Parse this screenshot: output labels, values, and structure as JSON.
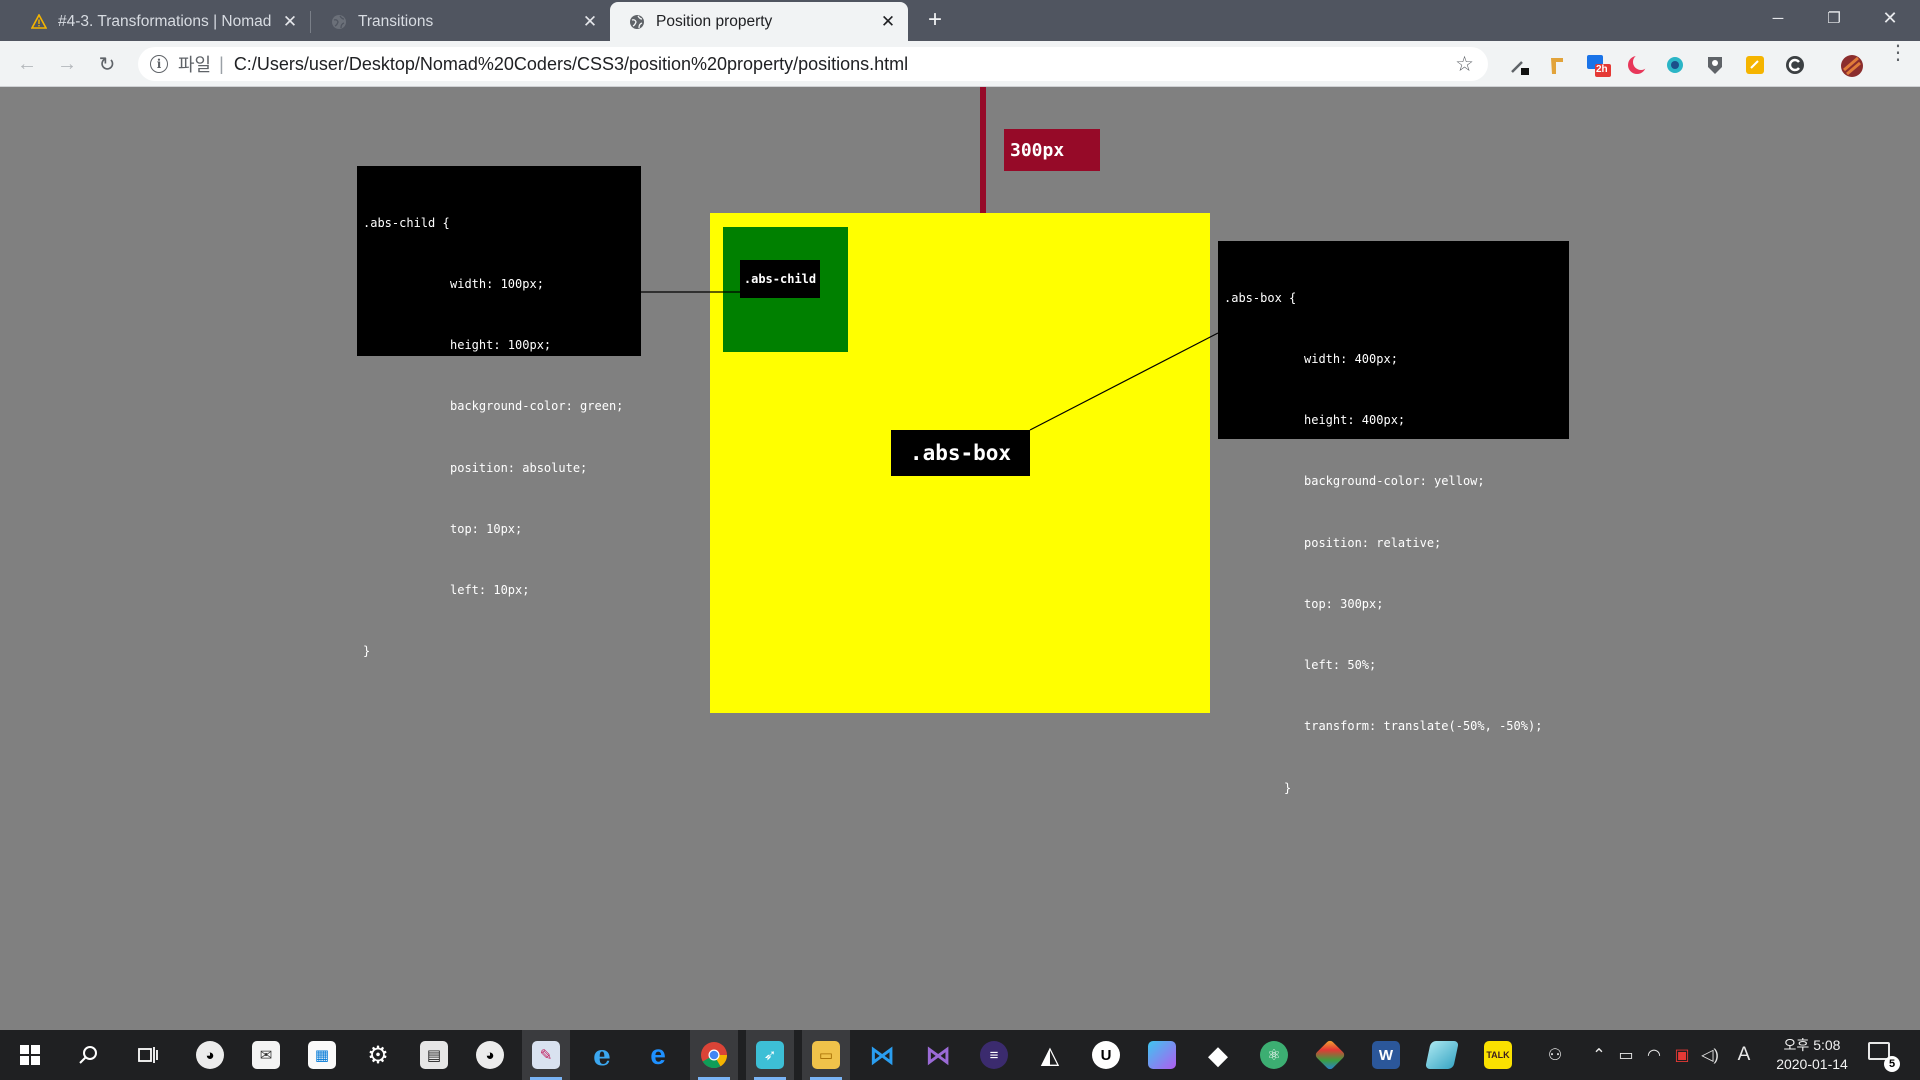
{
  "tabs": [
    {
      "title": "#4-3. Transformations | Nomad",
      "icon": "warning-triangle-icon",
      "active": false
    },
    {
      "title": "Transitions",
      "icon": "globe-icon",
      "active": false
    },
    {
      "title": "Position property",
      "icon": "globe-icon",
      "active": true
    }
  ],
  "address_bar": {
    "scheme_label": "파일",
    "separator": "|",
    "url": "C:/Users/user/Desktop/Nomad%20Coders/CSS3/position%20property/positions.html"
  },
  "extensions": {
    "badge_2h": "2h"
  },
  "page": {
    "red_marker_label": "300px",
    "abs_child_label": ".abs-child",
    "abs_box_label": ".abs-box",
    "child_code": {
      "open": ".abs-child {",
      "lines": [
        "width: 100px;",
        "height: 100px;",
        "background-color: green;",
        "position: absolute;",
        "top: 10px;",
        "left: 10px;"
      ],
      "close": "}"
    },
    "box_code": {
      "open": ".abs-box {",
      "lines": [
        "width: 400px;",
        "height: 400px;",
        "background-color: yellow;",
        "position: relative;",
        "top: 300px;",
        "left: 50%;",
        "transform: translate(-50%, -50%);"
      ],
      "close": "}"
    }
  },
  "taskbar": {
    "tray_ime": "A",
    "clock_ampm_time": "오후 5:08",
    "clock_date": "2020-01-14",
    "notification_count": "5",
    "kakao_label": "TALK",
    "word_label": "W"
  },
  "colors": {
    "page_bg": "#808080",
    "box_yellow": "#ffff00",
    "child_green": "#008000",
    "marker_red": "#960a28"
  }
}
